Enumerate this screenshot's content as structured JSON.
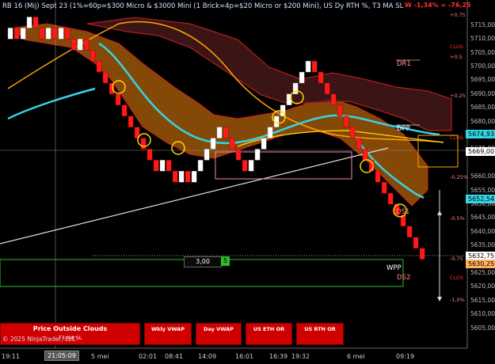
{
  "header": {
    "title": "RB 16 (Mij) Sept 23 (1%=60p=$300 Micro & $3000 Mini  (1 Brick=4p=$20 Micro or $200 Mini), US Dy RTH %, T3 MA SL"
  },
  "pnl": "W -1,34% = -76,25",
  "price_axis": [
    "5715,00",
    "5710,00",
    "5705,00",
    "5700,00",
    "5695,00",
    "5690,00",
    "5685,00",
    "5680,00",
    "5670,00",
    "5660,00",
    "5655,00",
    "5650,00",
    "5645,00",
    "5640,00",
    "5635,00",
    "5625,00",
    "5620,00",
    "5615,00",
    "5610,00",
    "5605,00"
  ],
  "price_tags": {
    "cyan": "5674,93",
    "current": "5669,00",
    "cyan2": "5652,54",
    "white": "5632,75",
    "orange": "5630,25"
  },
  "pct_labels": {
    "p075": "+0,75",
    "clos_top": "CLOS",
    "p05": "+0,5",
    "p025": "+0,25",
    "clos_mid": "CLOS",
    "m025": "-0,25%",
    "m05": "-0,5%",
    "m075": "-0,75",
    "clos_bot": "CLOS",
    "m1": "-1,0%"
  },
  "levels": {
    "dr1": "DR1",
    "dpp": "DPP",
    "ds1": "DS1",
    "wpp": "WPP",
    "ds2": "DS2"
  },
  "time_axis": [
    "19:11",
    "5 mei",
    "02:01",
    "08:41",
    "14:09",
    "16:01",
    "16:39",
    "19:32",
    "6 mei",
    "09:19"
  ],
  "cursor_time": "21:05:09",
  "order": {
    "qty": "3,00",
    "btn": "5"
  },
  "buttons": {
    "price_outside": "Price Outside Clouds",
    "t3_ma_sl": "T3 MA SL",
    "wkly_vwap": "Wkly VWAP",
    "day_vwap": "Day VWAP",
    "us_eth_or": "US ETH OR",
    "us_rth_or": "US RTH OR"
  },
  "copyright": "© 2025 NinjaTrader, LLC",
  "chart_data": {
    "type": "renko",
    "brick_size": 4,
    "bricks_close": [
      5714,
      5710,
      5714,
      5718,
      5714,
      5710,
      5714,
      5710,
      5714,
      5710,
      5706,
      5710,
      5706,
      5702,
      5698,
      5694,
      5690,
      5686,
      5682,
      5678,
      5674,
      5670,
      5666,
      5662,
      5666,
      5662,
      5658,
      5662,
      5658,
      5662,
      5666,
      5670,
      5674,
      5678,
      5674,
      5670,
      5666,
      5662,
      5666,
      5670,
      5674,
      5678,
      5682,
      5686,
      5690,
      5694,
      5698,
      5702,
      5698,
      5694,
      5690,
      5686,
      5682,
      5678,
      5674,
      5670,
      5666,
      5662,
      5658,
      5654,
      5650,
      5646,
      5642,
      5638,
      5634,
      5630
    ],
    "ylim": [
      5602,
      5719
    ],
    "colors": {
      "up": "#ffffff",
      "down": "#ff1a1a",
      "cloud": "#b0620a",
      "cyan_ma": "#33d6e6",
      "orange_ma": "#ffa500",
      "yellow_ma": "#ffd700"
    }
  }
}
